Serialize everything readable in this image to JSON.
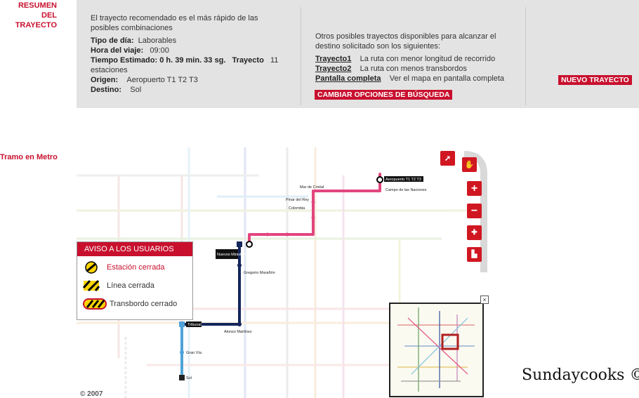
{
  "headings": {
    "summary_line1": "RESUMEN",
    "summary_line2": "DEL TRAYECTO",
    "metro_section": "Tramo en Metro"
  },
  "summary": {
    "intro": "El trayecto recomendado es el más rápido de las posibles combinaciones",
    "day_type_label": "Tipo de día:",
    "day_type_value": "Laborables",
    "time_label": "Hora del viaje:",
    "time_value": "09:00",
    "estimated_label": "Tiempo Estimado:",
    "estimated_value": "0 h. 39 min. 33 sg.",
    "route_label": "Trayecto",
    "route_value": "11",
    "route_suffix": "estaciones",
    "origin_label": "Origen:",
    "origin_value": "Aeropuerto T1 T2 T3",
    "dest_label": "Destino:",
    "dest_value": "Sol"
  },
  "alternatives": {
    "intro_line1": "Otros posibles trayectos disponibles para alcanzar el",
    "intro_line2": "destino solicitado son los siguientes:",
    "items": [
      {
        "link": "Trayecto1",
        "desc": "La ruta con menor longitud de recorrido"
      },
      {
        "link": "Trayecto2",
        "desc": "La ruta con menos transbordos"
      },
      {
        "link": "Pantalla completa",
        "desc": "Ver el mapa en pantalla completa"
      }
    ],
    "change_options_button": "CAMBIAR OPCIONES DE BÚSQUEDA"
  },
  "new_route_button": "NUEVO TRAYECTO",
  "map": {
    "stations": {
      "aeropuerto": "Aeropuerto T1 T2 T3",
      "campo_naciones": "Campo de las Naciones",
      "mar_cristal": "Mar de Cristal",
      "pinar": "Pinar del Rey",
      "colombia": "Colombia",
      "nuevos_ministerios": "Nuevos Ministerios",
      "gregorio_maranon": "Gregorio Marañón",
      "alonso_martinez": "Alonso Martínez",
      "tribunal": "Tribunal",
      "gran_via": "Gran Vía",
      "sol": "Sol"
    },
    "copyright": "© 2007"
  },
  "notice": {
    "title": "AVISO A LOS USUARIOS",
    "items": [
      {
        "label": "Estación cerrada"
      },
      {
        "label": "Línea cerrada"
      },
      {
        "label": "Transbordo cerrado"
      }
    ]
  },
  "signature": "Sundaycooks ©",
  "colors": {
    "brand_red": "#c8102e",
    "route_pink": "#e2467f",
    "route_navy": "#14265c",
    "route_lightblue": "#4fa3d8"
  }
}
